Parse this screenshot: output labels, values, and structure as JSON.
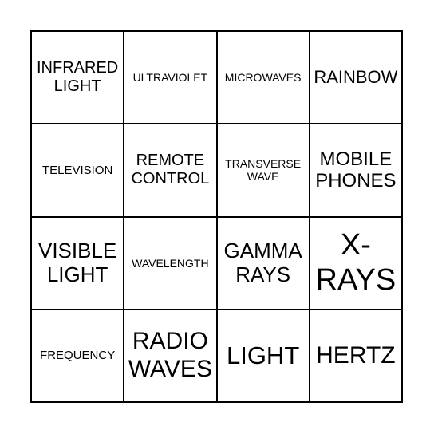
{
  "cells": [
    "INFRARED LIGHT",
    "ULTRAVIOLET",
    "MICROWAVES",
    "RAINBOW",
    "TELEVISION",
    "REMOTE CONTROL",
    "TRANSVERSE WAVE",
    "MOBILE PHONES",
    "VISIBLE LIGHT",
    "WAVELENGTH",
    "GAMMA RAYS",
    "X-RAYS",
    "FREQUENCY",
    "RADIO WAVES",
    "LIGHT",
    "HERTZ"
  ]
}
